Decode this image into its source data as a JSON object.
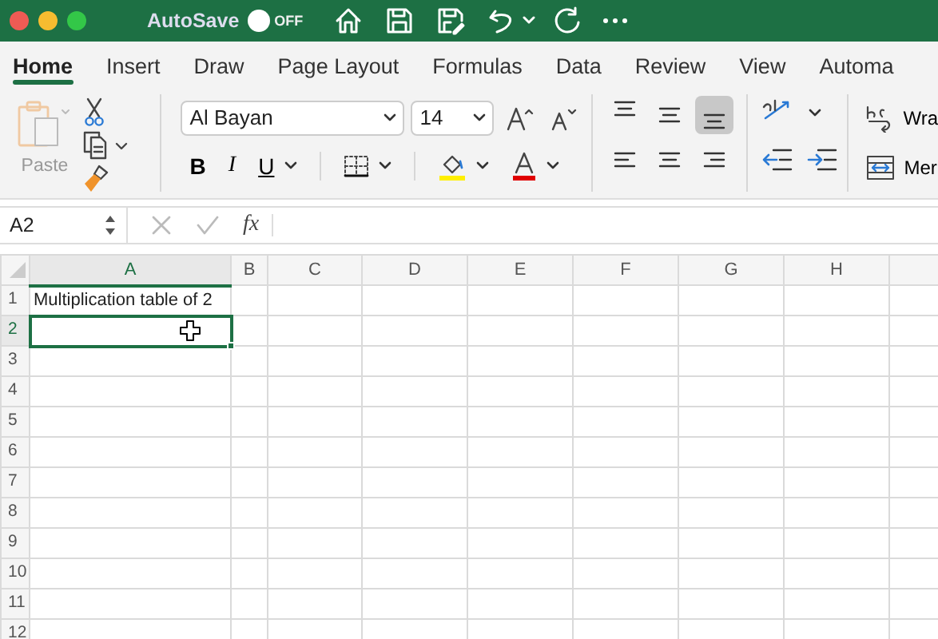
{
  "title_bar": {
    "autosave_label": "AutoSave",
    "autosave": {
      "on": false,
      "label": "OFF"
    }
  },
  "tabs": [
    {
      "label": "Home",
      "selected": true
    },
    {
      "label": "Insert",
      "selected": false
    },
    {
      "label": "Draw",
      "selected": false
    },
    {
      "label": "Page Layout",
      "selected": false
    },
    {
      "label": "Formulas",
      "selected": false
    },
    {
      "label": "Data",
      "selected": false
    },
    {
      "label": "Review",
      "selected": false
    },
    {
      "label": "View",
      "selected": false
    },
    {
      "label": "Automa",
      "selected": false
    }
  ],
  "ribbon": {
    "paste_label": "Paste",
    "font_name": "Al Bayan",
    "font_size": "14",
    "bold": "B",
    "italic": "I",
    "underline": "U",
    "wrap_label": "Wra",
    "merge_label": "Mer",
    "vertical_alignment": [
      {
        "kind": "top",
        "selected": false
      },
      {
        "kind": "middle",
        "selected": false
      },
      {
        "kind": "bottom",
        "selected": true
      }
    ]
  },
  "formula_bar": {
    "name_box": "A2",
    "fx": "fx"
  },
  "sheet": {
    "columns": [
      {
        "label": "A",
        "selected": true
      },
      {
        "label": "B",
        "selected": false
      },
      {
        "label": "C",
        "selected": false
      },
      {
        "label": "D",
        "selected": false
      },
      {
        "label": "E",
        "selected": false
      },
      {
        "label": "F",
        "selected": false
      },
      {
        "label": "G",
        "selected": false
      },
      {
        "label": "H",
        "selected": false
      }
    ],
    "rows": [
      {
        "label": "1",
        "selected": false,
        "text": "Multiplication table of 2"
      },
      {
        "label": "2",
        "selected": true
      },
      {
        "label": "3",
        "selected": false
      },
      {
        "label": "4",
        "selected": false
      },
      {
        "label": "5",
        "selected": false
      },
      {
        "label": "6",
        "selected": false
      },
      {
        "label": "7",
        "selected": false
      },
      {
        "label": "8",
        "selected": false
      },
      {
        "label": "9",
        "selected": false
      },
      {
        "label": "10",
        "selected": false
      },
      {
        "label": "11",
        "selected": false
      },
      {
        "label": "12",
        "selected": false
      }
    ]
  }
}
